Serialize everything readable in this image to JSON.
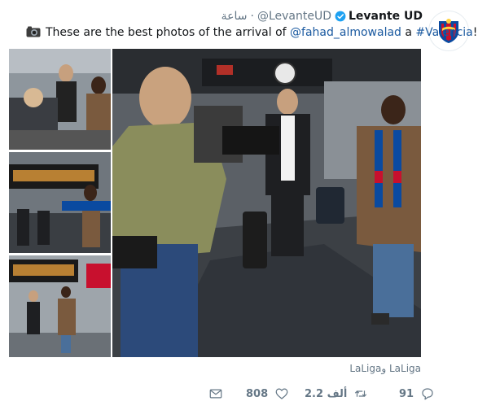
{
  "header": {
    "name": "Levante UD",
    "handle": "@LevanteUD",
    "dot": "·",
    "time": "ساعة"
  },
  "tweet": {
    "text_before": "These are the best photos of the arrival of ",
    "mention": "@fahad_almowalad",
    "text_middle": " a ",
    "hashtag": "#Valencia",
    "text_after": "!!"
  },
  "media": {
    "attribution": "LaLigaو LaLiga"
  },
  "actions": {
    "reply_count": "91",
    "retweet_count": "2.2 ألف",
    "like_count": "808"
  },
  "colors": {
    "link": "#1b5aa0",
    "muted": "#657786",
    "verified": "#1da1f2",
    "levante_blue": "#0a4aa0",
    "levante_red": "#c8102e"
  },
  "icons": {
    "verified": "verified-badge-icon",
    "camera": "camera-emoji-icon",
    "reply": "reply-icon",
    "retweet": "retweet-icon",
    "like": "heart-icon",
    "dm": "envelope-icon"
  }
}
